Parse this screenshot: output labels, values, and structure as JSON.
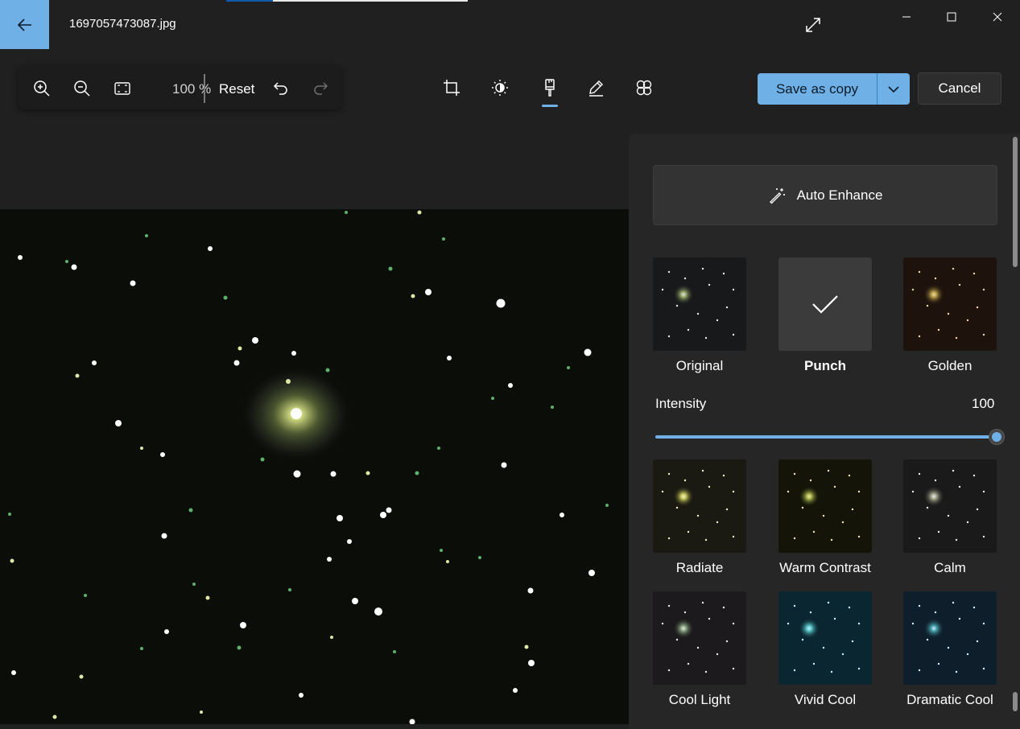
{
  "window": {
    "title": "1697057473087.jpg"
  },
  "toolbar": {
    "zoom_level": "100 %",
    "reset_label": "Reset",
    "save_label": "Save as copy",
    "cancel_label": "Cancel"
  },
  "panel": {
    "auto_enhance_label": "Auto Enhance",
    "intensity_label": "Intensity",
    "intensity_value": "100",
    "intensity_fraction": 1.0,
    "filters": [
      {
        "label": "Original",
        "selected": false
      },
      {
        "label": "Punch",
        "selected": true
      },
      {
        "label": "Golden",
        "selected": false
      },
      {
        "label": "Radiate",
        "selected": false
      },
      {
        "label": "Warm Contrast",
        "selected": false
      },
      {
        "label": "Calm",
        "selected": false
      },
      {
        "label": "Cool Light",
        "selected": false
      },
      {
        "label": "Vivid Cool",
        "selected": false
      },
      {
        "label": "Dramatic Cool",
        "selected": false
      }
    ]
  },
  "colors": {
    "accent": "#6fb0e6",
    "background": "#202020",
    "panel": "#262626"
  },
  "icons": {
    "back": "arrow-left-icon",
    "expand": "expand-icon",
    "zoom_in": "zoom-in-icon",
    "zoom_out": "zoom-out-icon",
    "fit": "fit-to-window-icon",
    "undo": "undo-icon",
    "redo": "redo-icon",
    "crop": "crop-icon",
    "adjust": "brightness-icon",
    "filter": "filter-brush-icon",
    "markup": "markup-pen-icon",
    "retouch": "retouch-icon",
    "auto_enhance": "magic-wand-icon"
  }
}
